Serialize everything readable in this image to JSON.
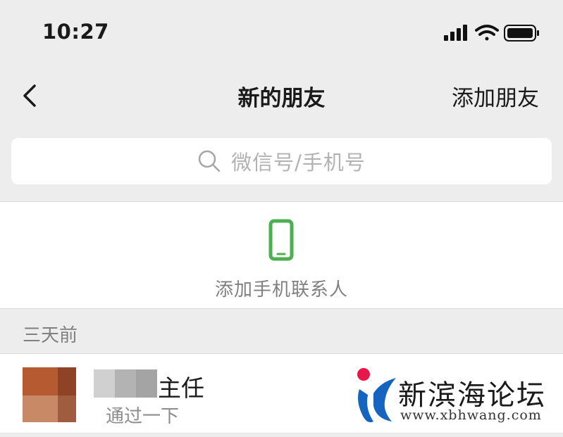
{
  "status_bar": {
    "time": "10:27",
    "icons": [
      "signal-icon",
      "wifi-icon",
      "battery-icon"
    ]
  },
  "nav": {
    "back_icon": "chevron-left-icon",
    "title": "新的朋友",
    "action_label": "添加朋友"
  },
  "search": {
    "icon": "search-icon",
    "placeholder": "微信号/手机号"
  },
  "add_contacts": {
    "icon": "phone-icon",
    "label": "添加手机联系人",
    "icon_color": "#4caf50"
  },
  "section": {
    "header": "三天前"
  },
  "requests": [
    {
      "name": "主任",
      "message": "通过一下",
      "avatar": "blurred-avatar"
    }
  ],
  "watermark": {
    "name": "新滨海论坛",
    "url": "www.xbhwang.com"
  },
  "colors": {
    "background": "#ededed",
    "accent_green": "#4caf50",
    "secondary_text": "#808080",
    "watermark_red": "#e8174a",
    "watermark_blue": "#1565c0"
  }
}
